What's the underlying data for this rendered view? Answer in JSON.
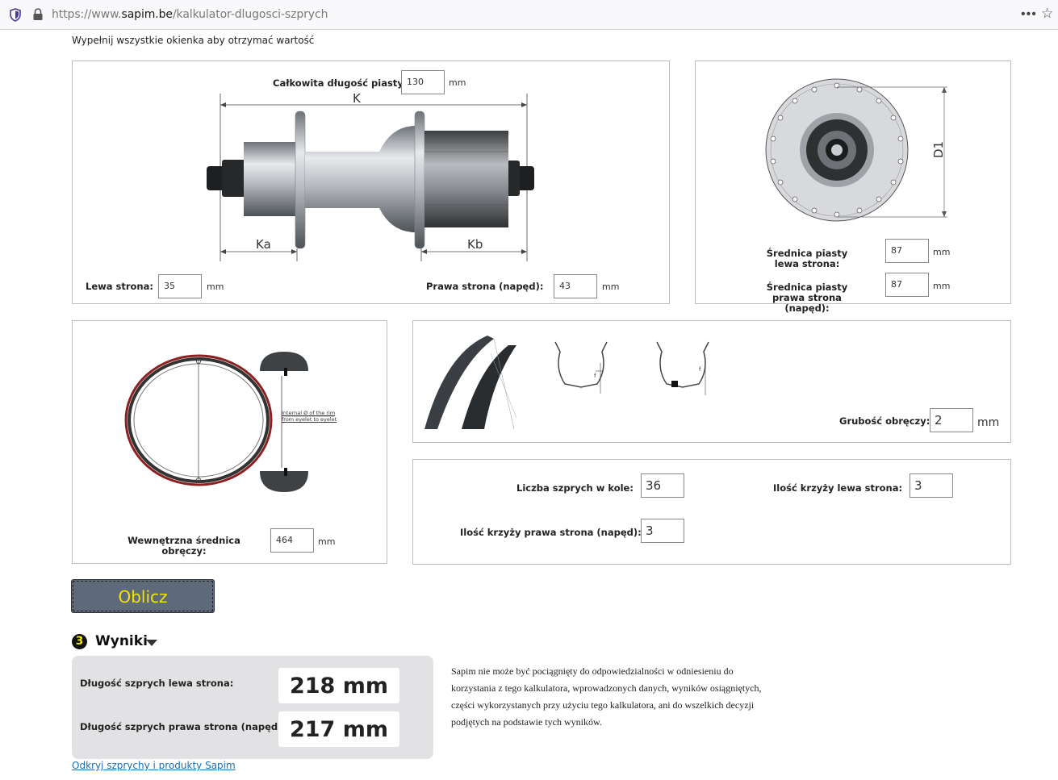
{
  "browser": {
    "url_scheme": "https://www.",
    "url_domain": "sapim.be",
    "url_path": "/kalkulator-dlugosci-szprych"
  },
  "instruction": "Wypełnij wszystkie okienka aby otrzymać wartość",
  "hub": {
    "total_width_label": "Całkowita długość piasty:",
    "total_width_value": "130",
    "unit": "mm",
    "dim_k": "K",
    "dim_ka": "Ka",
    "dim_kb": "Kb",
    "left_label": "Lewa strona:",
    "left_value": "35",
    "right_label": "Prawa strona (napęd):",
    "right_value": "43"
  },
  "flange": {
    "dim_d1": "D1",
    "left_label": "Średnica piasty lewa strona:",
    "left_value": "87",
    "right_label": "Średnica piasty prawa strona (napęd):",
    "right_value": "87",
    "unit": "mm"
  },
  "rim": {
    "label": "Wewnętrzna średnica obręczy:",
    "value": "464",
    "unit": "mm",
    "diagram_note": "Internal Ø of the rim from eyelet to eyelet"
  },
  "rim_thickness": {
    "label": "Grubość obręczy:",
    "value": "2",
    "unit": "mm",
    "dim_f": "f"
  },
  "spokes": {
    "count_label": "Liczba szprych w kole:",
    "count_value": "36",
    "cross_left_label": "Ilość krzyży lewa strona:",
    "cross_left_value": "3",
    "cross_right_label": "Ilość krzyży prawa strona (napęd):",
    "cross_right_value": "3"
  },
  "calculate_button": "Oblicz",
  "results": {
    "step": "3",
    "title": "Wyniki",
    "left_label": "Długość szprych lewa strona:",
    "left_value": "218 mm",
    "right_label": "Długość szprych prawa strona (napęd):",
    "right_value": "217 mm"
  },
  "disclaimer": "Sapim nie może być pociągnięty do odpowiedzialności w odniesieniu do korzystania z tego kalkulatora, wprowadzonych danych, wyników osiągniętych, części wykorzystanych przy użyciu tego kalkulatora, ani do wszelkich decyzji podjętych na podstawie tych wyników.",
  "link": "Odkryj szprychy i produkty Sapim",
  "colors": {
    "button_bg": "#5e6a79",
    "button_text": "#f2e600",
    "link": "#1b6fb3"
  }
}
